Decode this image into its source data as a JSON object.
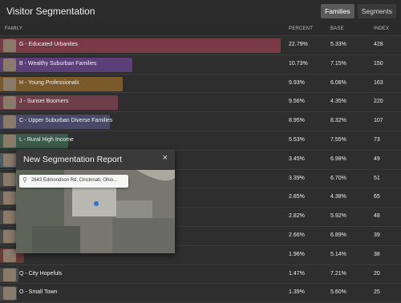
{
  "header": {
    "title": "Visitor Segmentation",
    "tabs": [
      {
        "label": "Families",
        "active": true
      },
      {
        "label": "Segments",
        "active": false
      }
    ]
  },
  "columns": {
    "family": "FAMILY",
    "percent": "PERCENT",
    "base": "BASE",
    "index": "INDEX"
  },
  "rows": [
    {
      "name": "G - Educated Urbanites",
      "percent": "22.79%",
      "base": "5.33%",
      "index": "428",
      "bar_pct": 22.79,
      "color": "#7a3a45"
    },
    {
      "name": "B - Wealthy Suburban Families",
      "percent": "10.73%",
      "base": "7.15%",
      "index": "150",
      "bar_pct": 10.73,
      "color": "#5a3f78"
    },
    {
      "name": "H - Young Professionals",
      "percent": "9.93%",
      "base": "6.08%",
      "index": "163",
      "bar_pct": 9.93,
      "color": "#7a5a2a"
    },
    {
      "name": "J - Sunset Boomers",
      "percent": "9.56%",
      "base": "4.35%",
      "index": "220",
      "bar_pct": 9.56,
      "color": "#6e3f4a"
    },
    {
      "name": "C - Upper Suburban Diverse Families",
      "percent": "8.95%",
      "base": "8.32%",
      "index": "107",
      "bar_pct": 8.95,
      "color": "#4a4a68"
    },
    {
      "name": "L - Rural High Income",
      "percent": "5.53%",
      "base": "7.55%",
      "index": "73",
      "bar_pct": 5.53,
      "color": "#3a5a4a"
    },
    {
      "name": "",
      "percent": "3.45%",
      "base": "6.98%",
      "index": "49",
      "bar_pct": 3.45,
      "color": "#4a5a6a"
    },
    {
      "name": "",
      "percent": "3.39%",
      "base": "6.70%",
      "index": "51",
      "bar_pct": 3.39,
      "color": "#4a4a4a"
    },
    {
      "name": "",
      "percent": "2.85%",
      "base": "4.38%",
      "index": "65",
      "bar_pct": 2.85,
      "color": "#4a4a4a"
    },
    {
      "name": "",
      "percent": "2.82%",
      "base": "5.92%",
      "index": "48",
      "bar_pct": 2.82,
      "color": "#4a4a4a"
    },
    {
      "name": "",
      "percent": "2.66%",
      "base": "6.89%",
      "index": "39",
      "bar_pct": 2.66,
      "color": "#4a4a4a"
    },
    {
      "name": "",
      "percent": "1.96%",
      "base": "5.14%",
      "index": "38",
      "bar_pct": 1.96,
      "color": "#6a3a3a"
    },
    {
      "name": "Q - City Hopefuls",
      "percent": "1.47%",
      "base": "7.21%",
      "index": "20",
      "bar_pct": 1.47,
      "color": "#4a4a4a"
    },
    {
      "name": "O - Small Town",
      "percent": "1.39%",
      "base": "5.60%",
      "index": "25",
      "bar_pct": 1.39,
      "color": "#4a4a4a"
    }
  ],
  "modal": {
    "title": "New Segmentation Report",
    "close": "×",
    "search_value": "2643 Edmondson Rd, Cincinnati, Ohio..."
  }
}
